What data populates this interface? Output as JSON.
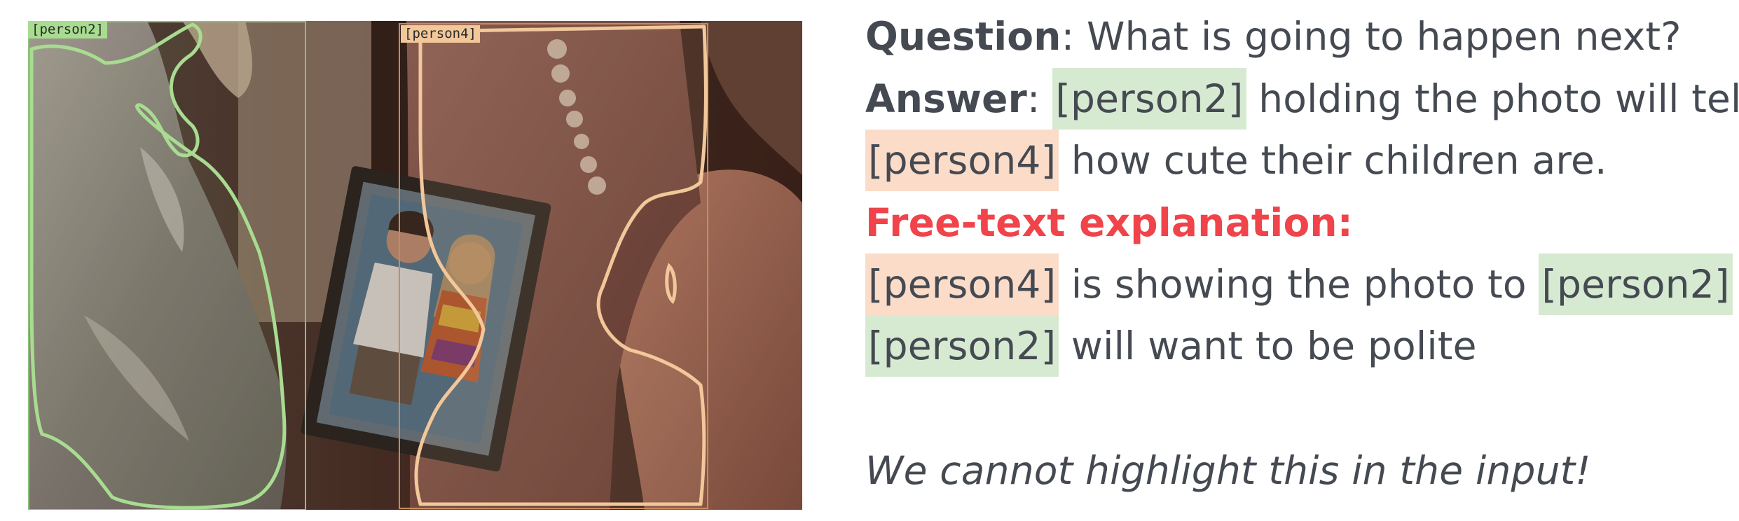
{
  "detections": [
    {
      "tag": "[person2]",
      "color": "#a8dc90"
    },
    {
      "tag": "[person4]",
      "color": "#f2c79a"
    }
  ],
  "question": {
    "label": "Question",
    "sep": ":",
    "text": " What is going to happen next?"
  },
  "answer": {
    "label": "Answer",
    "sep": ":",
    "ref_a": "[person2]",
    "text_a": " holding the photo will tell",
    "ref_b": "[person4]",
    "text_b": " how cute their children are."
  },
  "explanation": {
    "heading": "Free-text explanation:",
    "line1_ref_a": "[person4]",
    "line1_text": " is showing the photo to ",
    "line1_ref_b": "[person2]",
    "line2_ref": "[person2]",
    "line2_text": " will want to be polite"
  },
  "note": "We cannot highlight this in the input!",
  "colors": {
    "text": "#454a52",
    "red_heading": "#f0444a",
    "highlight_green": "#d6ead1",
    "highlight_orange": "#fbdcc8"
  }
}
